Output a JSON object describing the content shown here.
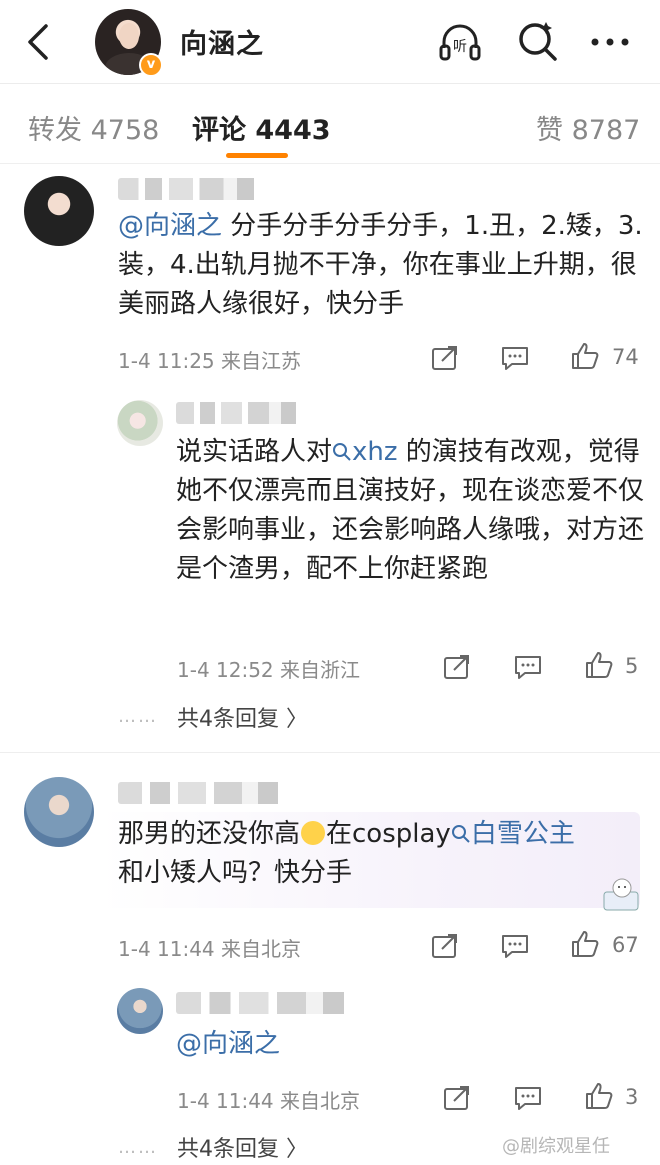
{
  "header": {
    "title": "向涵之",
    "listen_label": "听",
    "badge": "v"
  },
  "tabs": {
    "repost": "转发 4758",
    "comments": "评论 4443",
    "likes": "赞 8787"
  },
  "comments": [
    {
      "mention": "@向涵之",
      "text": " 分手分手分手分手，1.丑，2.矮，3.装，4.出轨月抛不干净，你在事业上升期，很美丽路人缘很好，快分手",
      "meta": "1-4 11:25 来自江苏",
      "likes": "74",
      "reply": {
        "text_before": "说实话路人对",
        "link": "xhz",
        "text_after": " 的演技有改观，觉得她不仅漂亮而且演技好，现在谈恋爱不仅会影响事业，还会影响路人缘哦，对方还是个渣男，配不上你赶紧跑",
        "meta": "1-4 12:52 来自浙江",
        "likes": "5"
      },
      "replies_label": "共4条回复 〉"
    },
    {
      "text_before": "那男的还没你高",
      "text_mid": "在cosplay",
      "link": "白雪公主",
      "text_after": "和小矮人吗？快分手",
      "meta": "1-4 11:44 来自北京",
      "likes": "67",
      "reply": {
        "mention": "@向涵之",
        "meta": "1-4 11:44 来自北京",
        "likes": "3"
      },
      "replies_label": "共4条回复 〉"
    }
  ],
  "watermark": "@剧综观星任",
  "colors": {
    "accent": "#ff8200",
    "link": "#3b6ea8"
  }
}
